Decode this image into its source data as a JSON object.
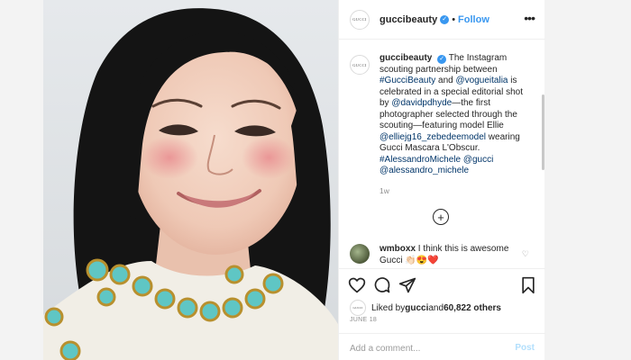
{
  "header": {
    "avatar_text": "GUCCI",
    "username": "guccibeauty",
    "verified_mark": "✓",
    "separator": "•",
    "follow_label": "Follow",
    "more_icon": "more-horizontal-icon"
  },
  "caption": {
    "avatar_text": "GUCCI",
    "username": "guccibeauty",
    "verified_mark": "✓",
    "parts": [
      " The Instagram scouting partnership between ",
      "#GucciBeauty",
      " and ",
      "@vogueitalia",
      " is celebrated in a special editorial shot by ",
      "@davidpdhyde",
      "—the first photographer selected through the scouting—featuring model Ellie ",
      "@elliejg16_zebedeemodel",
      " wearing Gucci Mascara L'Obscur. ",
      "#AlessandroMichele",
      " ",
      "@gucci",
      " ",
      "@alessandro_michele"
    ],
    "age": "1w"
  },
  "load_more_icon": "plus-circle-icon",
  "comment": {
    "username": "wmboxx",
    "text": " I think this is awesome Gucci 👏🏻😍❤️",
    "like_icon": "heart-outline-icon"
  },
  "actions": {
    "like_icon": "heart-icon",
    "comment_icon": "comment-icon",
    "share_icon": "paper-plane-icon",
    "save_icon": "bookmark-icon"
  },
  "likes": {
    "avatar_text": "GUCCI",
    "prefix": "Liked by ",
    "user": "gucci",
    "middle": " and ",
    "others": "60,822 others"
  },
  "post_date": "JUNE 18",
  "add_comment": {
    "placeholder": "Add a comment...",
    "post_label": "Post"
  },
  "colors": {
    "link": "#003569",
    "follow": "#3897f0",
    "post_disabled": "#b2dffc"
  }
}
